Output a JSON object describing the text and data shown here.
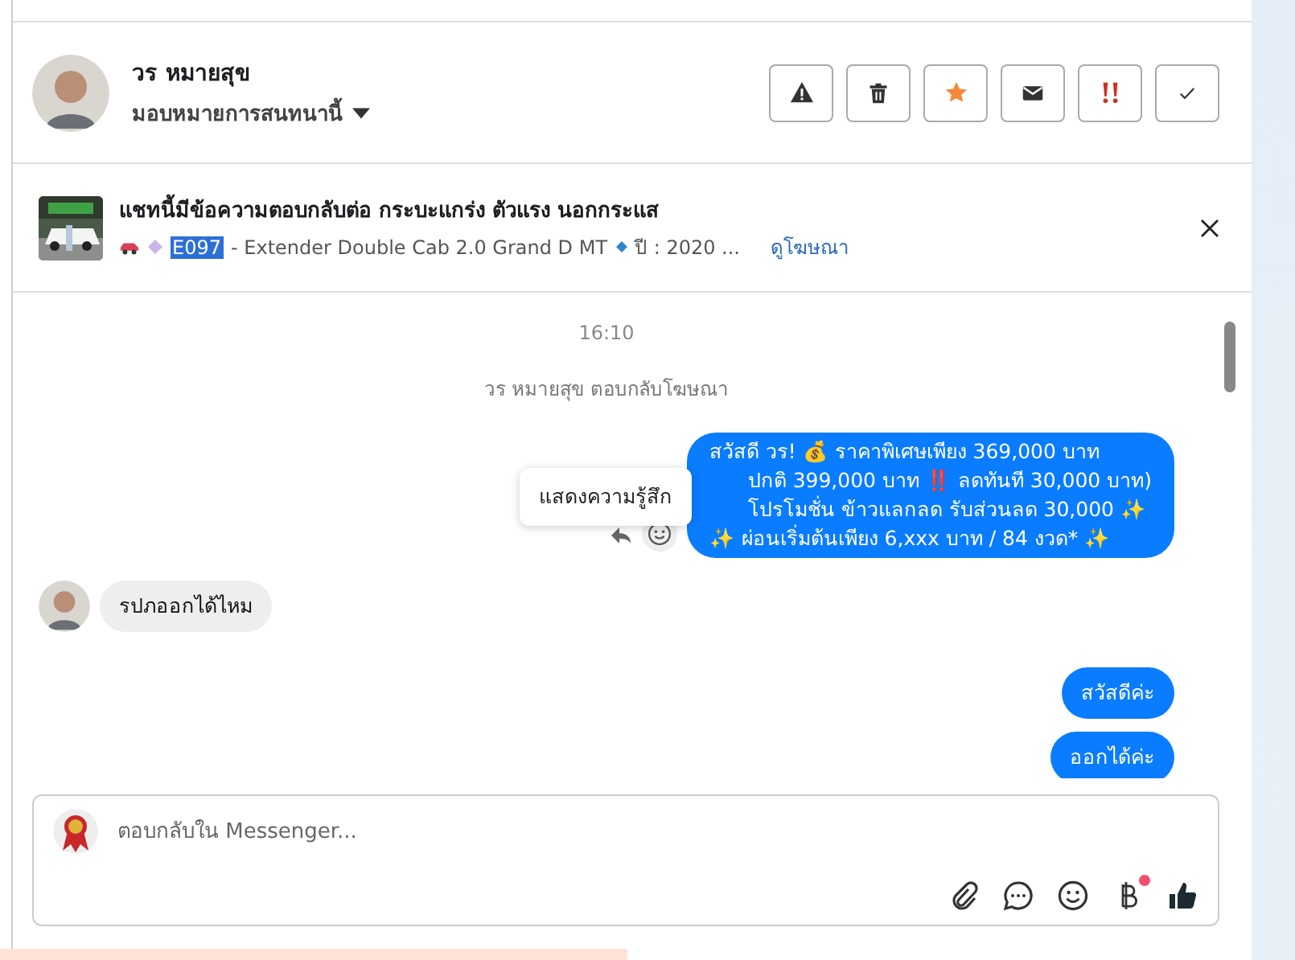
{
  "header": {
    "name": "วร หมายสุข",
    "assign_label": "มอบหมายการสนทนานี้",
    "actions": [
      {
        "kind": "spam"
      },
      {
        "kind": "delete"
      },
      {
        "kind": "star"
      },
      {
        "kind": "mail"
      },
      {
        "kind": "urgent"
      },
      {
        "kind": "done"
      }
    ]
  },
  "ad": {
    "title": "แชทนี้มีข้อความตอบกลับต่อ กระบะแกร่ง ตัวแรง นอกกระแส",
    "code": "E097",
    "detail": "- Extender Double Cab 2.0 Grand D MT",
    "year": "ปี : 2020 ...",
    "link": "ดูโฆษณา"
  },
  "messages": [
    {
      "kind": "time",
      "text": "16:10"
    },
    {
      "kind": "note",
      "text": "วร หมายสุข ตอบกลับโฆษณา"
    },
    {
      "kind": "outgoing",
      "lines": [
        "สวัสดี วร! 💰 ราคาพิเศษเพียง 369,000 บาท",
        "ปกติ 399,000 บาท ‼️ ลดทันที 30,000 บาท)",
        "โปรโมชั่น ข้าวแลกลด รับส่วนลด 30,000 ✨",
        "✨ ผ่อนเริ่มต้นเพียง 6,xxx บาท / 84 งวด* ✨"
      ],
      "tooltip": "แสดงความรู้สึก"
    },
    {
      "kind": "incoming",
      "lines": [
        "รปภออกได้ไหม"
      ]
    },
    {
      "kind": "outgoing",
      "lines": [
        "สวัสดีค่ะ"
      ]
    },
    {
      "kind": "outgoing",
      "lines": [
        "ออกได้ค่ะ"
      ]
    }
  ],
  "composer": {
    "placeholder": "ตอบกลับใน Messenger...",
    "tools": [
      {
        "kind": "attach"
      },
      {
        "kind": "chat"
      },
      {
        "kind": "emoji"
      },
      {
        "kind": "baht",
        "badge": true
      },
      {
        "kind": "like"
      }
    ]
  }
}
